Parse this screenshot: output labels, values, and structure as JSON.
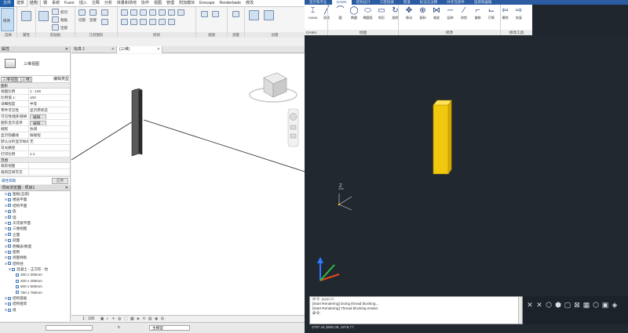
{
  "revit": {
    "tabs": [
      "文件",
      "建筑",
      "结构",
      "钢",
      "系统",
      "Fuzor",
      "插入",
      "注释",
      "分析",
      "体量和场地",
      "协作",
      "视图",
      "管理",
      "附加模块",
      "Enscape",
      "Renderbade",
      "修改"
    ],
    "ribbon": {
      "modify_label": "修改",
      "panels": [
        "选择",
        "属性",
        "剪贴板",
        "几何图形",
        "修改",
        "视图",
        "测量",
        "创建"
      ],
      "clipboard_items": [
        "剪切",
        "粘贴",
        "连接"
      ],
      "geometry_items": [
        "切割",
        "连接"
      ]
    },
    "properties": {
      "title": "属性",
      "type_name": "三维视图",
      "view_filter": "三维视图: {三维}",
      "edit_type": "编辑类型",
      "group_graphics": "图形",
      "rows": [
        {
          "k": "视图比例",
          "v": "1 : 100"
        },
        {
          "k": "比例值 1:",
          "v": "100"
        },
        {
          "k": "详细程度",
          "v": "中等"
        },
        {
          "k": "零件可见性",
          "v": "显示原状态"
        },
        {
          "k": "可见性/图形替换",
          "v": "编辑..."
        },
        {
          "k": "图形显示选项",
          "v": "编辑..."
        },
        {
          "k": "规程",
          "v": "协调"
        },
        {
          "k": "显示隐藏线",
          "v": "按规程"
        },
        {
          "k": "默认分析显示样式",
          "v": "无"
        },
        {
          "k": "日光路径",
          "v": ""
        },
        {
          "k": "打印比例",
          "v": "1:1"
        }
      ],
      "group_extents": "范围",
      "extent_rows": [
        {
          "k": "裁剪视图",
          "v": ""
        },
        {
          "k": "裁剪区域可见",
          "v": ""
        }
      ],
      "help_link": "属性帮助",
      "apply_label": "应用"
    },
    "browser": {
      "title": "项目浏览器 - 项目1",
      "items": [
        {
          "label": "图纸(全部)",
          "indent": 1
        },
        {
          "label": "楼层平面",
          "indent": 1
        },
        {
          "label": "结构平面",
          "indent": 1
        },
        {
          "label": "族",
          "indent": 1
        },
        {
          "label": "墙",
          "indent": 1
        },
        {
          "label": "天花板平面",
          "indent": 1
        },
        {
          "label": "三维视图",
          "indent": 1
        },
        {
          "label": "立面",
          "indent": 1
        },
        {
          "label": "剖面",
          "indent": 1
        },
        {
          "label": "明细表/数量",
          "indent": 1
        },
        {
          "label": "图例",
          "indent": 1
        },
        {
          "label": "视图样板",
          "indent": 1
        },
        {
          "label": "结构柱",
          "indent": 1
        },
        {
          "label": "混凝土 - 正方形 - 柱",
          "indent": 2
        },
        {
          "label": "300 x 300mm",
          "indent": 3
        },
        {
          "label": "400 x 400mm",
          "indent": 3
        },
        {
          "label": "600 x 600mm",
          "indent": 3
        },
        {
          "label": "750 x 750mm",
          "indent": 3
        },
        {
          "label": "结构基础",
          "indent": 1
        },
        {
          "label": "结构框架",
          "indent": 1
        },
        {
          "label": "组",
          "indent": 1
        }
      ]
    },
    "view_tabs": [
      "标高 1",
      "{三维}"
    ],
    "view_status": {
      "scale": "1 : 100"
    },
    "status": {
      "filter_value": "0",
      "model_value": "主模型"
    }
  },
  "cad": {
    "tabs": [
      "显示和专业",
      "GAMA",
      "结构设计",
      "工程快速",
      "管道",
      "标注与注释",
      "共享连接件",
      "选择和编辑"
    ],
    "active_tab": "GAMA",
    "ribbon": {
      "tools": [
        {
          "glyph": "⌶",
          "label": "GAMA"
        },
        {
          "glyph": "╱",
          "label": "直线"
        },
        {
          "glyph": "⌒",
          "label": "圆"
        },
        {
          "glyph": "◯",
          "label": "椭圆"
        },
        {
          "glyph": "⬭",
          "label": "椭圆弧"
        },
        {
          "glyph": "▭",
          "label": "矩形"
        },
        {
          "glyph": "↻",
          "label": "旋转"
        },
        {
          "glyph": "✥",
          "label": "移动"
        },
        {
          "glyph": "⊕",
          "label": "复制"
        },
        {
          "glyph": "⋈",
          "label": "缩放"
        },
        {
          "glyph": "─",
          "label": "延伸"
        },
        {
          "glyph": "⁄",
          "label": "修剪"
        },
        {
          "glyph": "⌐",
          "label": "偏移"
        },
        {
          "glyph": "⌙",
          "label": "打断"
        },
        {
          "glyph": "⇦",
          "label": "撤销"
        },
        {
          "glyph": "⇨",
          "label": "恢复"
        }
      ],
      "groups": [
        "GAMA",
        "绘图",
        "修改",
        "修改工具"
      ]
    },
    "axis_label": "Z",
    "command_lines": [
      "命令: pgup id",
      "[Start Rendering] Doing thread blocking...",
      "[Start Rendering] Thread blocking ended.",
      "命令:"
    ],
    "coords": "2787.44,3990.09, 2078.77"
  }
}
